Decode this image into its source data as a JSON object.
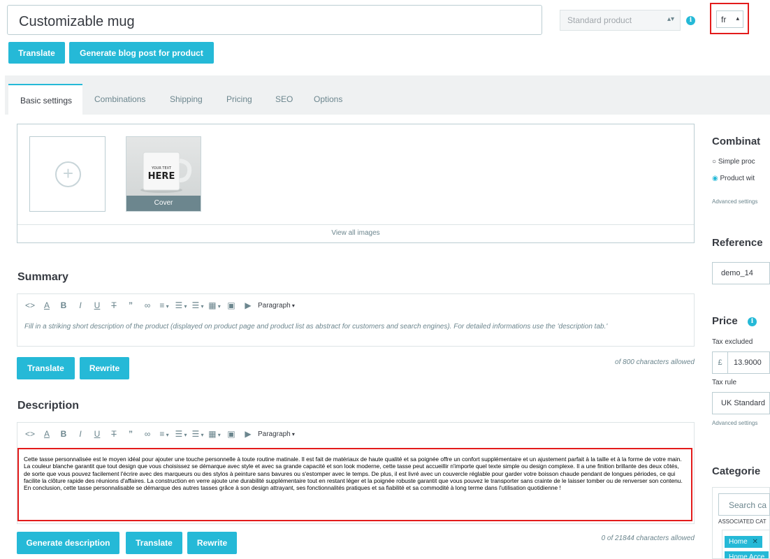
{
  "header": {
    "product_name": "Customizable mug",
    "product_type": "Standard product",
    "language": "fr",
    "translate_label": "Translate",
    "blog_label": "Generate blog post for product"
  },
  "tabs": [
    "Basic settings",
    "Combinations",
    "Shipping",
    "Pricing",
    "SEO",
    "Options"
  ],
  "images": {
    "thumb_line1": "YOUR TEXT",
    "thumb_line2": "HERE",
    "cover_label": "Cover",
    "view_all": "View all images"
  },
  "summary": {
    "title": "Summary",
    "block_format": "Paragraph",
    "placeholder": "Fill in a striking short description of the product (displayed on product page and product list as abstract for customers and search engines). For detailed informations use the 'description tab.'",
    "translate_label": "Translate",
    "rewrite_label": "Rewrite",
    "counter": "of 800 characters allowed"
  },
  "description": {
    "title": "Description",
    "block_format": "Paragraph",
    "text": "Cette tasse personnalisée est le moyen idéal pour ajouter une touche personnelle à toute routine matinale. Il est fait de matériaux de haute qualité et sa poignée offre un confort supplémentaire et un ajustement parfait à la taille et à la forme de votre main. La couleur blanche garantit que tout design que vous choisissez se démarque avec style et avec sa grande capacité et son look moderne, cette tasse peut accueillir n'importe quel texte simple ou design complexe. Il a une finition brillante des deux côtés, de sorte que vous pouvez facilement l'écrire avec des marqueurs ou des stylos à peinture sans bavures ou s'estomper avec le temps. De plus, il est livré avec un couvercle réglable pour garder votre boisson chaude pendant de longues périodes, ce qui facilite la clôture rapide des réunions d'affaires. La construction en verre ajoute une durabilité supplémentaire tout en restant léger et la poignée robuste garantit que vous pouvez le transporter sans crainte de le laisser tomber ou de renverser son contenu. En conclusion, cette tasse personnalisable se démarque des autres tasses grâce à son design attrayant, ses fonctionnalités pratiques et sa fiabilité et sa commodité à long terme dans l'utilisation quotidienne !",
    "generate_label": "Generate description",
    "translate_label": "Translate",
    "rewrite_label": "Rewrite",
    "counter": "0 of 21844 characters allowed"
  },
  "sidebar": {
    "combinations_title": "Combinat",
    "simple_option": "Simple proc",
    "with_option": "Product wit",
    "advanced_1": "Advanced settings",
    "reference_title": "Reference",
    "reference_value": "demo_14",
    "price_title": "Price",
    "tax_excluded": "Tax excluded",
    "currency": "£",
    "price_value": "13.9000",
    "tax_rule_label": "Tax rule",
    "tax_rule_value": "UK Standard",
    "advanced_2": "Advanced settings",
    "categories_title": "Categorie",
    "search_placeholder": "Search ca",
    "associated_label": "ASSOCIATED CAT",
    "tag_home": "Home",
    "tag_home_acc": "Home Acce"
  },
  "colors": {
    "accent": "#25b9d7",
    "highlight": "#e31b1b"
  }
}
